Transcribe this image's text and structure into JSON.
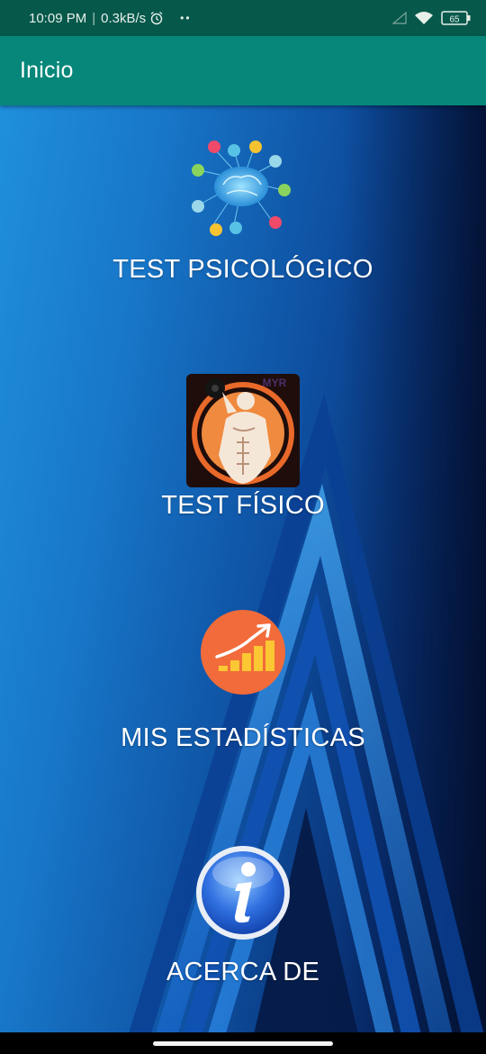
{
  "status_bar": {
    "time": "10:09 PM",
    "separator": "|",
    "speed": "0.3kB/s",
    "dots": "••",
    "battery": "65"
  },
  "app_bar": {
    "title": "Inicio"
  },
  "menu": {
    "items": [
      {
        "label": "TEST PSICOLÓGICO",
        "icon": "brain-network-icon"
      },
      {
        "label": "TEST FÍSICO",
        "icon": "bodybuilder-icon"
      },
      {
        "label": "MIS ESTADÍSTICAS",
        "icon": "growth-chart-icon"
      },
      {
        "label": "ACERCA DE",
        "icon": "info-icon"
      }
    ]
  },
  "colors": {
    "status_bar": "#06584b",
    "app_bar": "#06877a",
    "background_light": "#1f8fdc",
    "background_dark": "#051a44"
  }
}
